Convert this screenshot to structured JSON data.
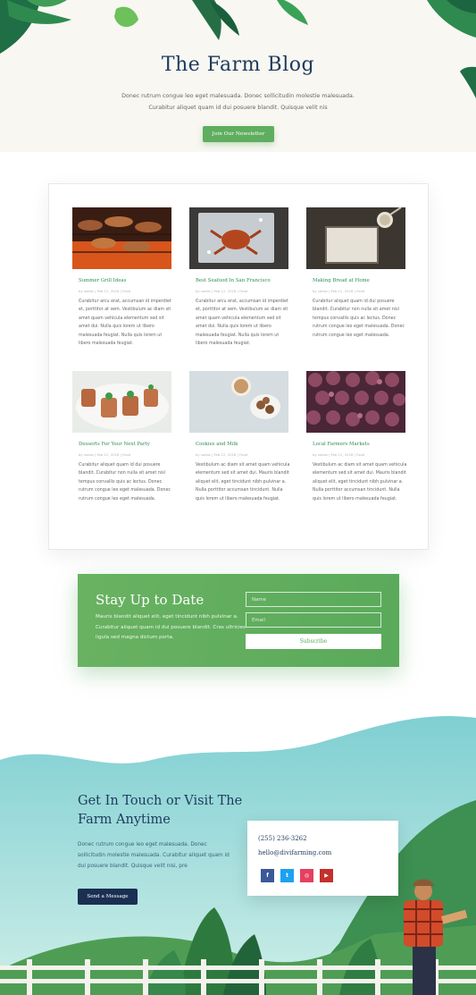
{
  "hero": {
    "title": "The Farm Blog",
    "subtitle": "Donec rutrum congue leo eget malesuada. Donec sollicitudin molestie malesuada. Curabitur aliquet quam id dui posuere blandit. Quisque velit nis",
    "button_label": "Join Our Newsletter"
  },
  "posts": [
    {
      "title": "Summer Grill Ideas",
      "meta": "by sodos | Feb 12, 2018 | Food",
      "excerpt": "Curabitur arcu erat, accumsan id imperdiet et, porttitor at sem. Vestibulum ac diam sit amet quam vehicula elementum sed sit amet dui. Nulla quis lorem ut libero malesuada feugiat. Nulla quis lorem ut libero malesuada feugiat."
    },
    {
      "title": "Best Seafood In San Francisco",
      "meta": "by sodos | Feb 12, 2018 | Food",
      "excerpt": "Curabitur arcu erat, accumsan id imperdiet et, porttitor at sem. Vestibulum ac diam sit amet quam vehicula elementum sed sit amet dui. Nulla quis lorem ut libero malesuada feugiat. Nulla quis lorem ut libero malesuada feugiat."
    },
    {
      "title": "Making Bread at Home",
      "meta": "by sodos | Feb 12, 2018 | Food",
      "excerpt": "Curabitur aliquet quam id dui posuere blandit. Curabitur non nulla sit amet nisl tempus convallis quis ac lectus. Donec rutrum congue leo eget malesuada. Donec rutrum congue leo eget malesuada."
    },
    {
      "title": "Desserts For Your Next Party",
      "meta": "by sodos | Feb 12, 2018 | Food",
      "excerpt": "Curabitur aliquet quam id dui posuere blandit. Curabitur non nulla sit amet nisl tempus convallis quis ac lectus. Donec rutrum congue leo eget malesuada. Donec rutrum congue leo eget malesuada."
    },
    {
      "title": "Cookies and Milk",
      "meta": "by sodos | Feb 12, 2018 | Food",
      "excerpt": "Vestibulum ac diam sit amet quam vehicula elementum sed sit amet dui. Mauris blandit aliquet elit, eget tincidunt nibh pulvinar a. Nulla porttitor accumsan tincidunt. Nulla quis lorem ut libero malesuada feugiat."
    },
    {
      "title": "Local Farmers Markets",
      "meta": "by sodos | Feb 12, 2018 | Food",
      "excerpt": "Vestibulum ac diam sit amet quam vehicula elementum sed sit amet dui. Mauris blandit aliquet elit, eget tincidunt nibh pulvinar a. Nulla porttitor accumsan tincidunt. Nulla quis lorem ut libero malesuada feugiat."
    }
  ],
  "newsletter": {
    "title": "Stay Up to Date",
    "text": "Mauris blandit aliquet elit, eget tincidunt nibh pulvinar a. Curabitur aliquet quam id dui posuere blandit. Cras ultricies ligula sed magna dictum porta.",
    "name_placeholder": "Name",
    "email_placeholder": "Email",
    "button_label": "Subscribe"
  },
  "contact": {
    "title": "Get In Touch or Visit The Farm Anytime",
    "text": "Donec rutrum congue leo eget malesuada. Donec sollicitudin molestie malesuada. Curabitur aliquet quam id dui posuere blandit. Quisque velit nisi, pre",
    "button_label": "Send a Message",
    "phone": "(255) 236-3262",
    "email": "hello@divifarming.com",
    "socials": [
      {
        "name": "facebook",
        "glyph": "f",
        "color": "#3b5998"
      },
      {
        "name": "twitter",
        "glyph": "t",
        "color": "#1da1f2"
      },
      {
        "name": "instagram",
        "glyph": "◎",
        "color": "#e4405f"
      },
      {
        "name": "youtube",
        "glyph": "▶",
        "color": "#c4302b"
      }
    ]
  },
  "colors": {
    "accent_green": "#5fad5e",
    "navy": "#1e3a5c",
    "post_title_green": "#2e8b57"
  }
}
